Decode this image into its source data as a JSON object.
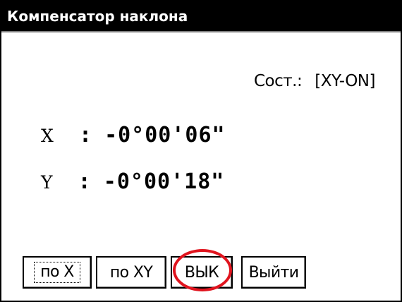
{
  "window": {
    "title": "Компенсатор наклона"
  },
  "status": {
    "label": "Сост.:",
    "value": "[XY-ON]"
  },
  "readings": {
    "x": {
      "axis": "X",
      "separator": ":",
      "value": "-0°00'06\""
    },
    "y": {
      "axis": "Y",
      "separator": ":",
      "value": "-0°00'18\""
    }
  },
  "buttons": {
    "by_x": "по X",
    "by_xy": "по XY",
    "off": "ВЫК",
    "exit": "Выйти"
  },
  "colors": {
    "titlebar": "#000000",
    "title_text": "#ffffff",
    "highlight": "#e0141e"
  }
}
